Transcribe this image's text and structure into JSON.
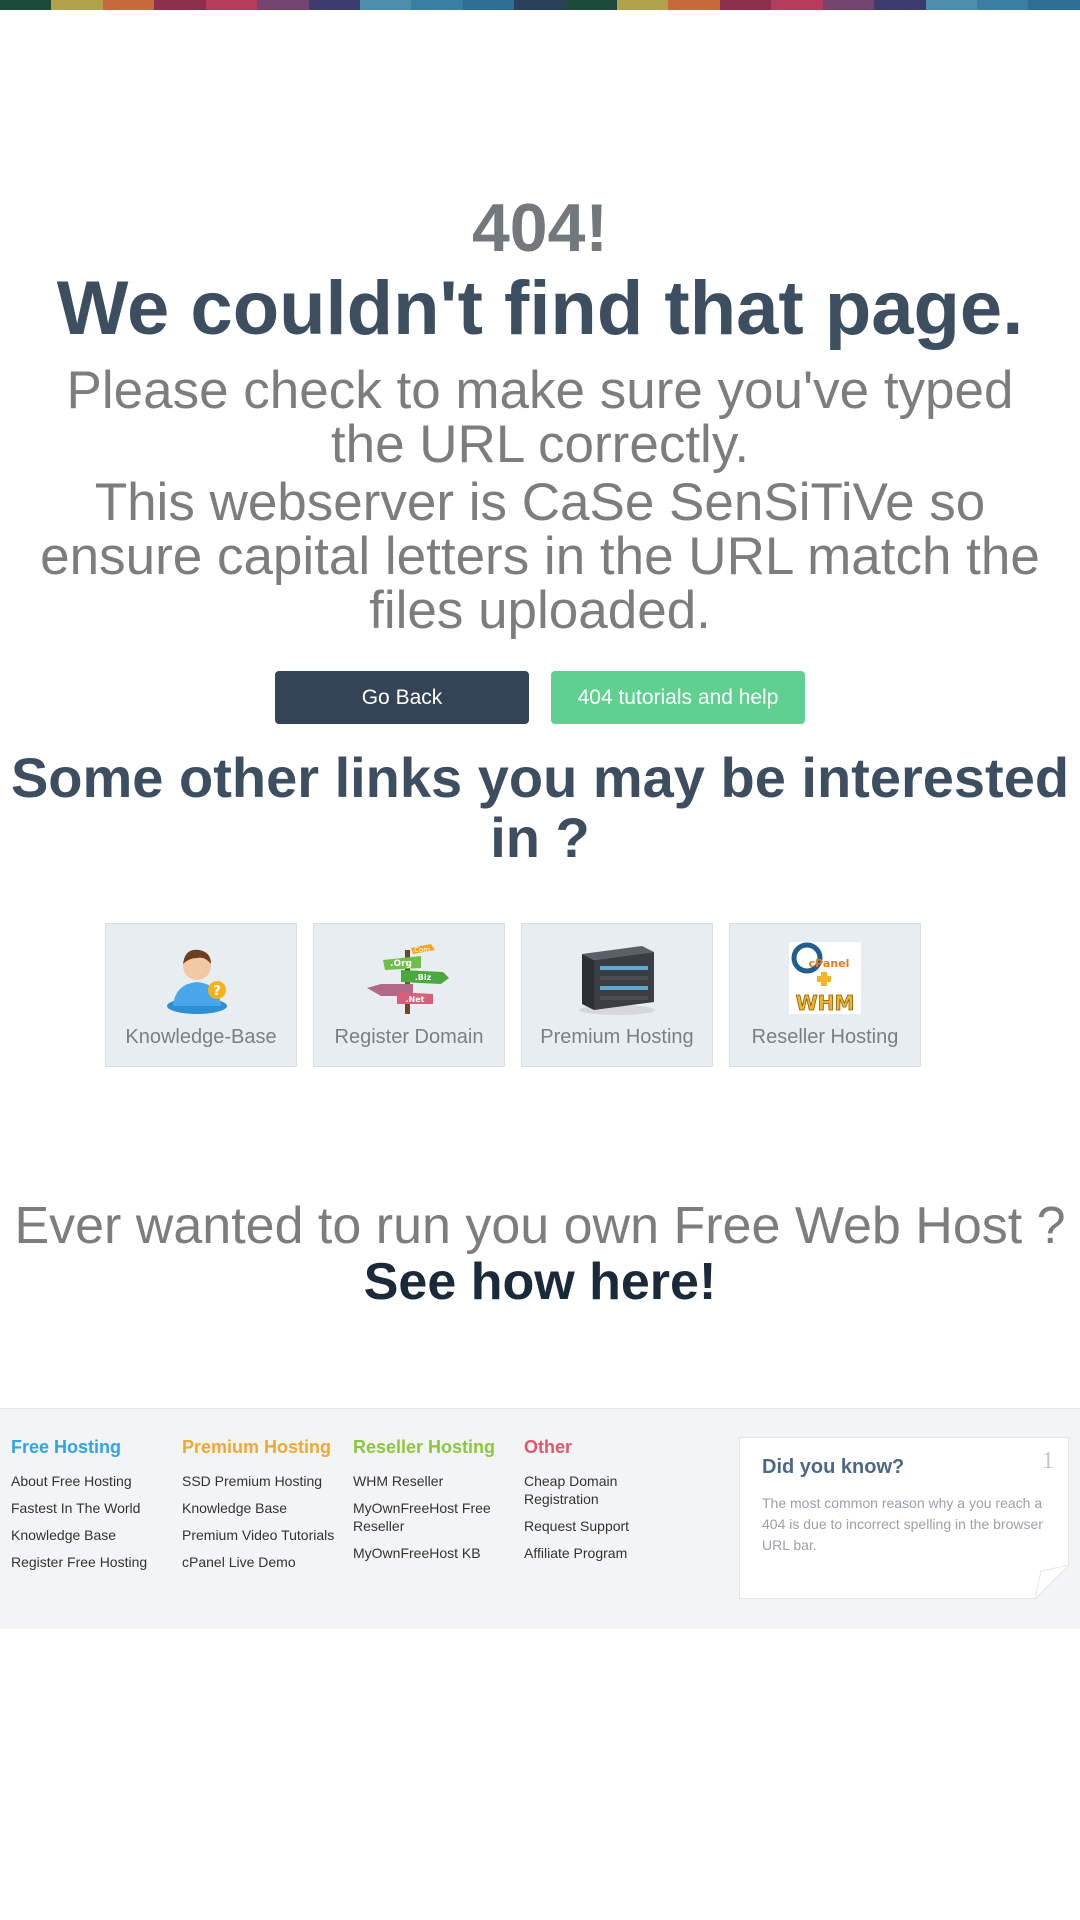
{
  "top_bar": {
    "colors": [
      "#1d4a3a",
      "#b0a24a",
      "#c7693a",
      "#8e2f4d",
      "#b63c5d",
      "#74446e",
      "#3c3b6e",
      "#4f8eaa",
      "#3a7fa3",
      "#2d6e92",
      "#27415a",
      "#1d4a3a",
      "#b0a24a",
      "#c7693a",
      "#8e2f4d",
      "#b63c5d",
      "#74446e",
      "#3c3b6e",
      "#4f8eaa",
      "#3a7fa3",
      "#2d6e92"
    ]
  },
  "error": {
    "code": "404!",
    "headline": "We couldn't find that page.",
    "message1": "Please check to make sure you've typed the URL correctly.",
    "message2": "This webserver is CaSe SenSiTiVe so ensure capital letters in the URL match the files uploaded."
  },
  "buttons": {
    "back_label": "Go Back",
    "help_label": "404 tutorials and help"
  },
  "links_section": {
    "title": "Some other links you may be interested in ?",
    "tiles": [
      {
        "label": "Knowledge-Base",
        "icon": "support-person-icon"
      },
      {
        "label": "Register Domain",
        "icon": "domain-signpost-icon"
      },
      {
        "label": "Premium Hosting",
        "icon": "server-icon"
      },
      {
        "label": "Reseller Hosting",
        "icon": "cpanel-whm-icon"
      }
    ]
  },
  "promo": {
    "text": "Ever wanted to run you own Free Web Host ?",
    "cta": "See how here!"
  },
  "footer": {
    "columns": [
      {
        "heading": "Free Hosting",
        "links": [
          "About Free Hosting",
          "Fastest In The World",
          "Knowledge Base",
          "Register Free Hosting"
        ]
      },
      {
        "heading": "Premium Hosting",
        "links": [
          "SSD Premium Hosting",
          "Knowledge Base",
          "Premium Video Tutorials",
          "cPanel Live Demo"
        ]
      },
      {
        "heading": "Reseller Hosting",
        "links": [
          "WHM Reseller",
          "MyOwnFreeHost Free Reseller",
          "MyOwnFreeHost KB"
        ]
      },
      {
        "heading": "Other",
        "links": [
          "Cheap Domain Registration",
          "Request Support",
          "Affiliate Program"
        ]
      }
    ],
    "did_you_know": {
      "title": "Did you know?",
      "number": "1",
      "text": "The most common reason why a you reach a 404 is due to incorrect spelling in the browser URL bar."
    }
  }
}
